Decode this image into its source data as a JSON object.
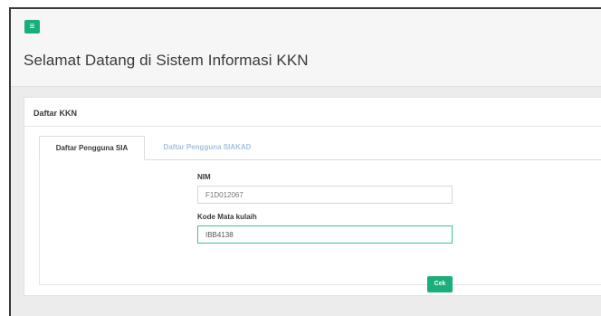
{
  "topbar": {
    "menu_icon": "hamburger-menu-icon",
    "menu_glyph": "≡"
  },
  "header": {
    "title": "Selamat Datang di Sistem Informasi KKN"
  },
  "panel": {
    "title": "Daftar KKN",
    "tabs": [
      {
        "label": "Daftar Pengguna SIA",
        "active": true
      },
      {
        "label": "Daftar Pengguna SIAKAD",
        "active": false
      }
    ]
  },
  "form": {
    "nim_label": "NIM",
    "nim_value": "F1D012067",
    "kode_label": "Kode Mata kulaih",
    "kode_value": "IBB4138",
    "submit_label": "Cek"
  },
  "colors": {
    "accent": "#1aae7a",
    "inactive_tab": "#a9c1dc",
    "focus_border": "#3cc49a"
  }
}
